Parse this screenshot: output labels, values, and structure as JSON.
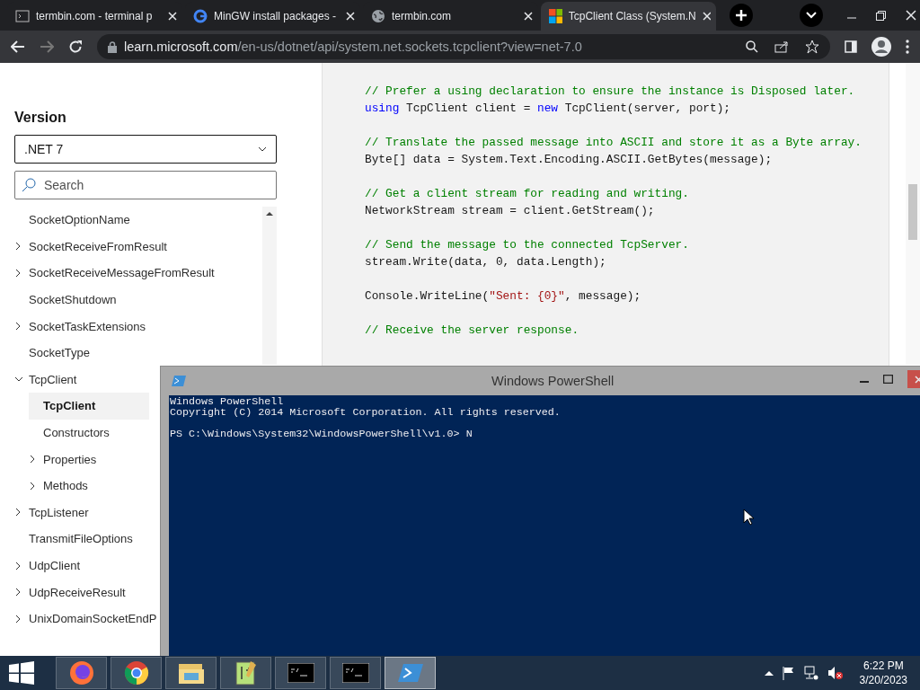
{
  "browser": {
    "tabs": [
      {
        "title": "termbin.com - terminal p",
        "kind": "terminal",
        "selected": false
      },
      {
        "title": "MinGW install packages -",
        "kind": "google",
        "selected": false
      },
      {
        "title": "termbin.com",
        "kind": "globe",
        "selected": false
      },
      {
        "title": "TcpClient Class (System.N",
        "kind": "microsoft",
        "selected": true
      }
    ],
    "address": {
      "host": "learn.microsoft.com",
      "path": "/en-us/dotnet/api/system.net.sockets.tcpclient?view=net-7.0"
    }
  },
  "sidebar": {
    "heading": "Version",
    "version_select": {
      "value": ".NET 7"
    },
    "search": {
      "placeholder": "Search"
    },
    "tree": [
      {
        "label": "SocketOptionName",
        "selected": false
      },
      {
        "label": "SocketReceiveFromResult",
        "expanded": false,
        "selected": false
      },
      {
        "label": "SocketReceiveMessageFromResult",
        "expanded": false,
        "selected": false
      },
      {
        "label": "SocketShutdown",
        "selected": false
      },
      {
        "label": "SocketTaskExtensions",
        "expanded": false,
        "selected": false
      },
      {
        "label": "SocketType",
        "selected": false
      },
      {
        "label": "TcpClient",
        "expanded": true,
        "selected": false,
        "children": [
          {
            "label": "TcpClient",
            "selected": true
          },
          {
            "label": "Constructors",
            "selected": false
          },
          {
            "label": "Properties",
            "expanded": false,
            "selected": false
          },
          {
            "label": "Methods",
            "expanded": false,
            "selected": false
          }
        ]
      },
      {
        "label": "TcpListener",
        "expanded": false,
        "selected": false
      },
      {
        "label": "TransmitFileOptions",
        "selected": false
      },
      {
        "label": "UdpClient",
        "expanded": false,
        "selected": false
      },
      {
        "label": "UdpReceiveResult",
        "expanded": false,
        "selected": false
      },
      {
        "label": "UnixDomainSocketEndP",
        "expanded": false,
        "selected": false
      }
    ]
  },
  "code_blocks": [
    [
      [
        {
          "text": "// Prefer a using declaration to ensure the instance is Disposed later.",
          "kind": "comment"
        }
      ],
      [
        {
          "text": "using",
          "kind": "keyword"
        },
        {
          "text": " TcpClient client = ",
          "kind": "plain"
        },
        {
          "text": "new",
          "kind": "keyword"
        },
        {
          "text": " TcpClient(server, port);",
          "kind": "plain"
        }
      ]
    ],
    [
      [
        {
          "text": "// Translate the passed message into ASCII and store it as a Byte array.",
          "kind": "comment"
        }
      ],
      [
        {
          "text": "Byte[] data = System.Text.Encoding.ASCII.GetBytes(message);",
          "kind": "plain"
        }
      ]
    ],
    [
      [
        {
          "text": "// Get a client stream for reading and writing.",
          "kind": "comment"
        }
      ],
      [
        {
          "text": "NetworkStream stream = client.GetStream();",
          "kind": "plain"
        }
      ]
    ],
    [
      [
        {
          "text": "// Send the message to the connected TcpServer.",
          "kind": "comment"
        }
      ],
      [
        {
          "text": "stream.Write(data, 0, data.Length);",
          "kind": "plain"
        }
      ]
    ],
    [
      [
        {
          "text": "Console.WriteLine(",
          "kind": "plain"
        },
        {
          "text": "\"Sent: {0}\"",
          "kind": "string"
        },
        {
          "text": ", message);",
          "kind": "plain"
        }
      ]
    ],
    [
      [
        {
          "text": "// Receive the server response.",
          "kind": "comment"
        }
      ]
    ]
  ],
  "powershell": {
    "title": "Windows PowerShell",
    "blocks": [
      [
        "Windows PowerShell",
        "Copyright (C) 2014 Microsoft Corporation. All rights reserved."
      ],
      [
        "PS C:\\Windows\\System32\\WindowsPowerShell\\v1.0> N"
      ]
    ]
  },
  "taskbar": {
    "apps": [
      {
        "kind": "firefox",
        "selected": false
      },
      {
        "kind": "chrome",
        "selected": false
      },
      {
        "kind": "explorer",
        "selected": false
      },
      {
        "kind": "notepad",
        "selected": false
      },
      {
        "kind": "cmd",
        "selected": false
      },
      {
        "kind": "cmd",
        "selected": false
      },
      {
        "kind": "powershell",
        "selected": true
      }
    ],
    "time": "6:22 PM",
    "date": "3/20/2023"
  }
}
